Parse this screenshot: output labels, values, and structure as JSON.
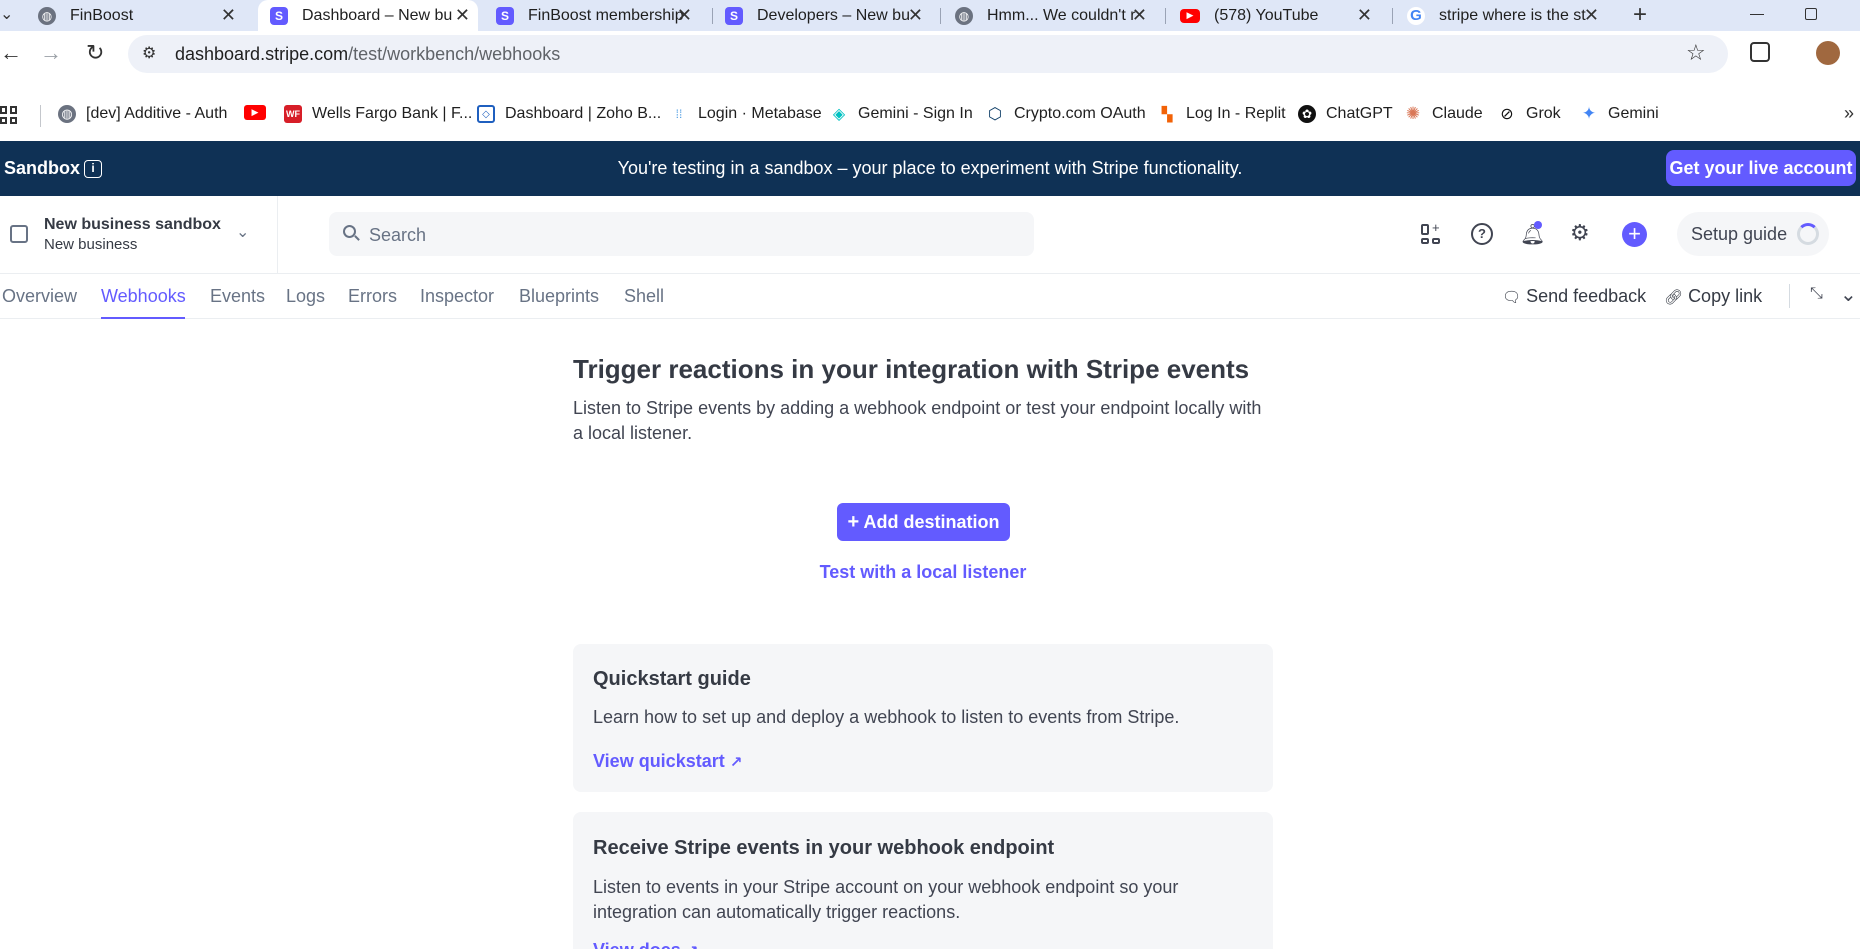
{
  "browser": {
    "tabs": [
      {
        "title": "FinBoost",
        "favicon": "globe-icon"
      },
      {
        "title": "Dashboard – New bu",
        "favicon": "stripe-icon"
      },
      {
        "title": "FinBoost membership",
        "favicon": "stripe-icon"
      },
      {
        "title": "Developers – New bu",
        "favicon": "stripe-icon"
      },
      {
        "title": "Hmm... We couldn't r",
        "favicon": "globe-icon"
      },
      {
        "title": "(578) YouTube",
        "favicon": "youtube-icon"
      },
      {
        "title": "stripe where is the st",
        "favicon": "google-icon"
      }
    ],
    "url_host": "dashboard.stripe.com",
    "url_path": "/test/workbench/webhooks",
    "bookmarks": [
      {
        "label": "[dev] Additive - Auth",
        "icon": "globe-icon"
      },
      {
        "label": "",
        "icon": "youtube-icon"
      },
      {
        "label": "Wells Fargo Bank | F...",
        "icon": "wellsfargo-icon"
      },
      {
        "label": "Dashboard | Zoho B...",
        "icon": "zoho-icon"
      },
      {
        "label": "Login · Metabase",
        "icon": "metabase-icon"
      },
      {
        "label": "Gemini - Sign In",
        "icon": "gemini-exchange-icon"
      },
      {
        "label": "Crypto.com OAuth",
        "icon": "crypto-icon"
      },
      {
        "label": "Log In - Replit",
        "icon": "replit-icon"
      },
      {
        "label": "ChatGPT",
        "icon": "openai-icon"
      },
      {
        "label": "Claude",
        "icon": "claude-icon"
      },
      {
        "label": "Grok",
        "icon": "grok-icon"
      },
      {
        "label": "Gemini",
        "icon": "gemini-icon"
      }
    ]
  },
  "banner": {
    "label": "Sandbox",
    "message": "You're testing in a sandbox – your place to experiment with Stripe functionality.",
    "cta": "Get your live account"
  },
  "account": {
    "name": "New business sandbox",
    "sub": "New business"
  },
  "search": {
    "placeholder": "Search"
  },
  "header": {
    "setup_guide": "Setup guide"
  },
  "subnav": {
    "tabs": [
      "Overview",
      "Webhooks",
      "Events",
      "Logs",
      "Errors",
      "Inspector",
      "Blueprints",
      "Shell"
    ],
    "active": "Webhooks",
    "send_feedback": "Send feedback",
    "copy_link": "Copy link"
  },
  "main": {
    "title": "Trigger reactions in your integration with Stripe events",
    "description": "Listen to Stripe events by adding a webhook endpoint or test your endpoint locally with a local listener.",
    "add_destination": "Add destination",
    "test_local": "Test with a local listener",
    "cards": [
      {
        "title": "Quickstart guide",
        "body": "Learn how to set up and deploy a webhook to listen to events from Stripe.",
        "link": "View quickstart"
      },
      {
        "title": "Receive Stripe events in your webhook endpoint",
        "body": "Listen to events in your Stripe account on your webhook endpoint so your integration can automatically trigger reactions.",
        "link": "View docs"
      }
    ]
  },
  "colors": {
    "accent": "#635bff",
    "banner": "#0f3155",
    "tabstrip": "#dfe7f7"
  }
}
